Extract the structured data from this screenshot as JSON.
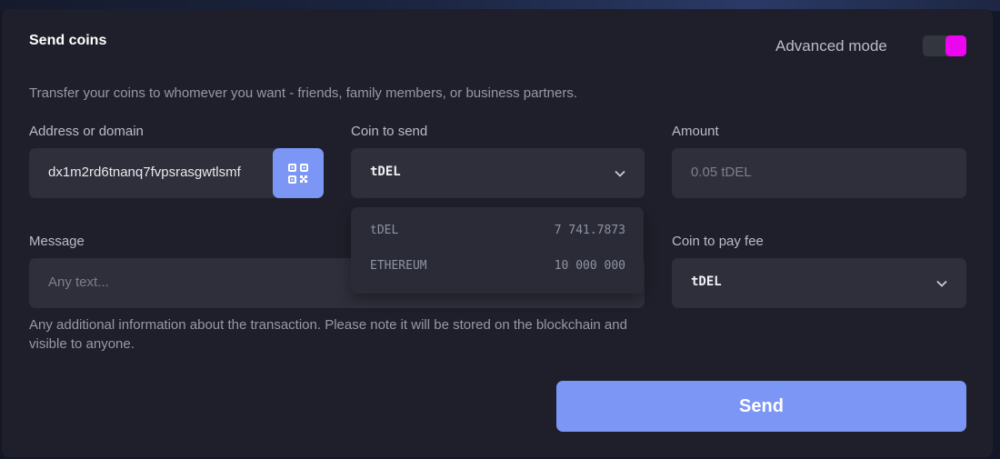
{
  "card": {
    "title": "Send coins",
    "advanced_mode_label": "Advanced mode",
    "advanced_mode_on": true,
    "description": "Transfer your coins to whomever you want - friends, family members, or business partners."
  },
  "address": {
    "label": "Address or domain",
    "value": "dx1m2rd6tnanq7fvpsrasgwtlsmf"
  },
  "coin_to_send": {
    "label": "Coin to send",
    "selected": "tDEL",
    "options": [
      {
        "name": "tDEL",
        "balance": "7 741.7873"
      },
      {
        "name": "ETHEREUM",
        "balance": "10 000 000"
      }
    ]
  },
  "amount": {
    "label": "Amount",
    "placeholder": "0.05 tDEL"
  },
  "message": {
    "label": "Message",
    "placeholder": "Any text...",
    "hint": "Any additional information about the transaction. Please note it will be stored on the blockchain and visible to anyone."
  },
  "fee_coin": {
    "label": "Coin to pay fee",
    "selected": "tDEL"
  },
  "actions": {
    "send_label": "Send"
  },
  "colors": {
    "accent": "#7b96f4",
    "toggle_on": "#ee05f0",
    "card_bg": "#1f1f2b",
    "field_bg": "#2f2f3b"
  }
}
